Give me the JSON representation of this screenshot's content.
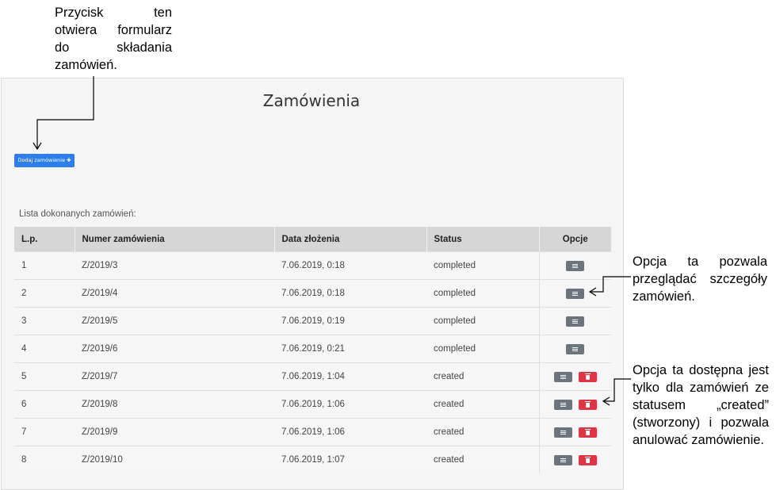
{
  "annotations": {
    "top": [
      "Przycisk ten",
      "otwiera formularz",
      "do składania",
      "zamówień."
    ],
    "middle": [
      "Opcja ta pozwala",
      "przeglądać szczegóły",
      "zamówień."
    ],
    "bottom": [
      "Opcja ta dostępna jest",
      "tylko dla zamówień ze",
      "statusem „created”",
      "(stworzony) i pozwala",
      "anulować zamówienie."
    ]
  },
  "page": {
    "title": "Zamówienia",
    "add_button_label": "Dodaj zamówienie ✚",
    "list_caption": "Lista dokonanych zamówień:"
  },
  "table": {
    "headers": {
      "lp": "L.p.",
      "number": "Numer zamówienia",
      "date": "Data złożenia",
      "status": "Status",
      "options": "Opcje"
    },
    "rows": [
      {
        "lp": "1",
        "number": "Z/2019/3",
        "date": "7.06.2019, 0:18",
        "status": "completed"
      },
      {
        "lp": "2",
        "number": "Z/2019/4",
        "date": "7.06.2019, 0:18",
        "status": "completed"
      },
      {
        "lp": "3",
        "number": "Z/2019/5",
        "date": "7.06.2019, 0:19",
        "status": "completed"
      },
      {
        "lp": "4",
        "number": "Z/2019/6",
        "date": "7.06.2019, 0:21",
        "status": "completed"
      },
      {
        "lp": "5",
        "number": "Z/2019/7",
        "date": "7.06.2019, 1:04",
        "status": "created"
      },
      {
        "lp": "6",
        "number": "Z/2019/8",
        "date": "7.06.2019, 1:06",
        "status": "created"
      },
      {
        "lp": "7",
        "number": "Z/2019/9",
        "date": "7.06.2019, 1:06",
        "status": "created"
      },
      {
        "lp": "8",
        "number": "Z/2019/10",
        "date": "7.06.2019, 1:07",
        "status": "created"
      }
    ]
  },
  "icons": {
    "details": "list-icon",
    "cancel": "trash-icon"
  },
  "colors": {
    "primary": "#2f7de9",
    "secondary": "#6c757d",
    "danger": "#dc3545",
    "header_bg": "#d6d6d6"
  }
}
